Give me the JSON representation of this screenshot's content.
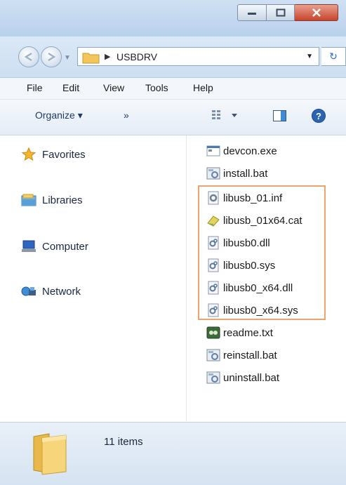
{
  "window": {
    "controls": {
      "minimize": "–",
      "maximize": "□",
      "close": "x"
    }
  },
  "address": {
    "path": "USBDRV"
  },
  "menu": [
    {
      "label": "File"
    },
    {
      "label": "Edit"
    },
    {
      "label": "View"
    },
    {
      "label": "Tools"
    },
    {
      "label": "Help"
    }
  ],
  "toolbar": {
    "organize": "Organize ▾",
    "more": "»"
  },
  "nav": [
    {
      "label": "Favorites",
      "icon": "star-icon"
    },
    {
      "label": "Libraries",
      "icon": "libraries-icon"
    },
    {
      "label": "Computer",
      "icon": "computer-icon"
    },
    {
      "label": "Network",
      "icon": "network-icon"
    }
  ],
  "files": [
    {
      "name": "devcon.exe",
      "icon": "exe-icon"
    },
    {
      "name": "install.bat",
      "icon": "bat-icon"
    },
    {
      "name": "libusb_01.inf",
      "icon": "inf-icon"
    },
    {
      "name": "libusb_01x64.cat",
      "icon": "cat-icon"
    },
    {
      "name": "libusb0.dll",
      "icon": "dll-icon"
    },
    {
      "name": "libusb0.sys",
      "icon": "sys-icon"
    },
    {
      "name": "libusb0_x64.dll",
      "icon": "dll-icon"
    },
    {
      "name": "libusb0_x64.sys",
      "icon": "sys-icon"
    },
    {
      "name": "readme.txt",
      "icon": "txt-icon"
    },
    {
      "name": "reinstall.bat",
      "icon": "bat-icon"
    },
    {
      "name": "uninstall.bat",
      "icon": "bat-icon"
    }
  ],
  "status": {
    "count": "11 items"
  },
  "colors": {
    "highlight": "#f0a36b",
    "close_button": "#c8432b"
  }
}
